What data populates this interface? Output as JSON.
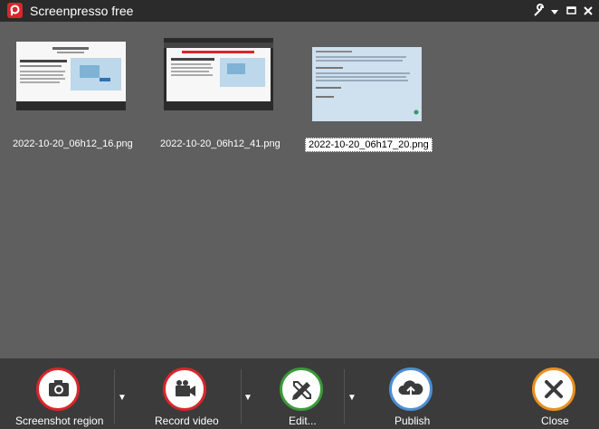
{
  "window": {
    "title": "Screenpresso free",
    "icons": [
      "wrench-icon",
      "caret-down-icon",
      "maximize-icon",
      "close-icon"
    ]
  },
  "gallery": {
    "items": [
      {
        "filename": "2022-10-20_06h12_16.png",
        "selected": false
      },
      {
        "filename": "2022-10-20_06h12_41.png",
        "selected": false
      },
      {
        "filename": "2022-10-20_06h17_20.png",
        "selected": true
      }
    ]
  },
  "toolbar": {
    "screenshot_label": "Screenshot region",
    "record_label": "Record video",
    "edit_label": "Edit...",
    "publish_label": "Publish",
    "close_label": "Close",
    "dropdown_glyph": "▼"
  },
  "colors": {
    "titlebar_bg": "#2b2b2b",
    "gallery_bg": "#5f5f5f",
    "toolbar_bg": "#3b3b3b",
    "screenshot_ring": "#d8262c",
    "record_ring": "#d8262c",
    "edit_ring": "#3a9a3a",
    "publish_ring": "#4a8fd4",
    "close_ring": "#e8901f"
  }
}
